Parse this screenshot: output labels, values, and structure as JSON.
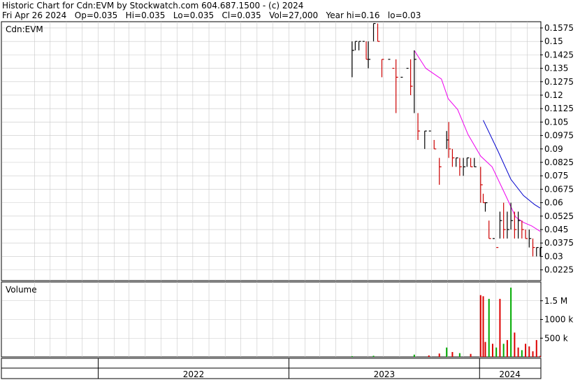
{
  "header": {
    "line1": "Historic Chart for Cdn:EVM by Stockwatch.com 604.687.1500 - (c) 2024",
    "line2": "Fri Apr 26 2024   Op=0.035   Hi=0.035   Lo=0.035   Cl=0.035   Vol=27,000   Year hi=0.16   lo=0.03"
  },
  "colors": {
    "up_bar": "#000000",
    "down_bar": "#cc0000",
    "ma_short": "#ee00ee",
    "ma_long": "#0000cc",
    "volume_up": "#00aa00",
    "volume_down": "#dd0000",
    "grid": "#c8c8c8"
  },
  "chart_data": [
    {
      "type": "ohlc",
      "panel_label": "Cdn:EVM",
      "price_ticks": [
        "0.1575",
        "0.15",
        "0.1425",
        "0.135",
        "0.1275",
        "0.12",
        "0.1125",
        "0.105",
        "0.0975",
        "0.09",
        "0.0825",
        "0.075",
        "0.0675",
        "0.06",
        "0.0525",
        "0.045",
        "0.0375",
        "0.03",
        "0.0225"
      ],
      "ylim": [
        0.0165,
        0.161
      ],
      "x_ticks": [
        "2022",
        "2023",
        "2024"
      ],
      "x_date_range": [
        "2021-07-01",
        "2024-04-26"
      ],
      "price_series": [
        {
          "date": "2023-05-02",
          "h": 0.15,
          "l": 0.13,
          "c": 0.145
        },
        {
          "date": "2023-05-08",
          "h": 0.15,
          "l": 0.145,
          "c": 0.15
        },
        {
          "date": "2023-05-15",
          "h": 0.15,
          "l": 0.145,
          "c": 0.15
        },
        {
          "date": "2023-05-22",
          "h": 0.15,
          "l": 0.15,
          "c": 0.15
        },
        {
          "date": "2023-05-29",
          "h": 0.15,
          "l": 0.14,
          "c": 0.14
        },
        {
          "date": "2023-06-02",
          "h": 0.15,
          "l": 0.135,
          "c": 0.14
        },
        {
          "date": "2023-06-12",
          "h": 0.16,
          "l": 0.15,
          "c": 0.16
        },
        {
          "date": "2023-06-20",
          "h": 0.16,
          "l": 0.15,
          "c": 0.15
        },
        {
          "date": "2023-06-28",
          "h": 0.14,
          "l": 0.13,
          "c": 0.14
        },
        {
          "date": "2023-07-10",
          "h": 0.14,
          "l": 0.14,
          "c": 0.14
        },
        {
          "date": "2023-07-18",
          "h": 0.135,
          "l": 0.135,
          "c": 0.135
        },
        {
          "date": "2023-07-25",
          "h": 0.14,
          "l": 0.11,
          "c": 0.13
        },
        {
          "date": "2023-08-03",
          "h": 0.13,
          "l": 0.13,
          "c": 0.13
        },
        {
          "date": "2023-08-14",
          "h": 0.135,
          "l": 0.135,
          "c": 0.135
        },
        {
          "date": "2023-08-22",
          "h": 0.14,
          "l": 0.12,
          "c": 0.125
        },
        {
          "date": "2023-08-29",
          "h": 0.145,
          "l": 0.11,
          "c": 0.14
        },
        {
          "date": "2023-09-05",
          "h": 0.11,
          "l": 0.095,
          "c": 0.1
        },
        {
          "date": "2023-09-18",
          "h": 0.1,
          "l": 0.09,
          "c": 0.1
        },
        {
          "date": "2023-09-26",
          "h": 0.1,
          "l": 0.1,
          "c": 0.1
        },
        {
          "date": "2023-10-06",
          "h": 0.095,
          "l": 0.09,
          "c": 0.09
        },
        {
          "date": "2023-10-16",
          "h": 0.085,
          "l": 0.07,
          "c": 0.08
        },
        {
          "date": "2023-10-30",
          "h": 0.1,
          "l": 0.09,
          "c": 0.095
        },
        {
          "date": "2023-11-03",
          "h": 0.105,
          "l": 0.085,
          "c": 0.09
        },
        {
          "date": "2023-11-10",
          "h": 0.09,
          "l": 0.08,
          "c": 0.085
        },
        {
          "date": "2023-11-17",
          "h": 0.085,
          "l": 0.08,
          "c": 0.085
        },
        {
          "date": "2023-11-24",
          "h": 0.085,
          "l": 0.075,
          "c": 0.08
        },
        {
          "date": "2023-12-01",
          "h": 0.085,
          "l": 0.075,
          "c": 0.08
        },
        {
          "date": "2023-12-08",
          "h": 0.085,
          "l": 0.08,
          "c": 0.085
        },
        {
          "date": "2023-12-15",
          "h": 0.085,
          "l": 0.08,
          "c": 0.08
        },
        {
          "date": "2023-12-22",
          "h": 0.085,
          "l": 0.08,
          "c": 0.08
        },
        {
          "date": "2024-01-03",
          "h": 0.08,
          "l": 0.06,
          "c": 0.07
        },
        {
          "date": "2024-01-08",
          "h": 0.065,
          "l": 0.06,
          "c": 0.06
        },
        {
          "date": "2024-01-12",
          "h": 0.06,
          "l": 0.055,
          "c": 0.06
        },
        {
          "date": "2024-01-19",
          "h": 0.05,
          "l": 0.04,
          "c": 0.04
        },
        {
          "date": "2024-01-26",
          "h": 0.04,
          "l": 0.04,
          "c": 0.04
        },
        {
          "date": "2024-02-02",
          "h": 0.035,
          "l": 0.035,
          "c": 0.035
        },
        {
          "date": "2024-02-09",
          "h": 0.055,
          "l": 0.04,
          "c": 0.05
        },
        {
          "date": "2024-02-16",
          "h": 0.06,
          "l": 0.04,
          "c": 0.045
        },
        {
          "date": "2024-02-23",
          "h": 0.055,
          "l": 0.04,
          "c": 0.045
        },
        {
          "date": "2024-03-01",
          "h": 0.06,
          "l": 0.045,
          "c": 0.05
        },
        {
          "date": "2024-03-08",
          "h": 0.055,
          "l": 0.04,
          "c": 0.045
        },
        {
          "date": "2024-03-15",
          "h": 0.055,
          "l": 0.04,
          "c": 0.05
        },
        {
          "date": "2024-03-22",
          "h": 0.05,
          "l": 0.04,
          "c": 0.045
        },
        {
          "date": "2024-03-29",
          "h": 0.045,
          "l": 0.04,
          "c": 0.04
        },
        {
          "date": "2024-04-05",
          "h": 0.045,
          "l": 0.035,
          "c": 0.04
        },
        {
          "date": "2024-04-12",
          "h": 0.04,
          "l": 0.03,
          "c": 0.035
        },
        {
          "date": "2024-04-19",
          "h": 0.035,
          "l": 0.03,
          "c": 0.035
        },
        {
          "date": "2024-04-26",
          "h": 0.035,
          "l": 0.03,
          "c": 0.035
        }
      ],
      "moving_averages": [
        {
          "color_key": "ma_short",
          "points": [
            {
              "date": "2023-08-29",
              "v": 0.145
            },
            {
              "date": "2023-09-20",
              "v": 0.135
            },
            {
              "date": "2023-10-20",
              "v": 0.129
            },
            {
              "date": "2023-11-02",
              "v": 0.118
            },
            {
              "date": "2023-11-20",
              "v": 0.112
            },
            {
              "date": "2023-12-10",
              "v": 0.098
            },
            {
              "date": "2024-01-03",
              "v": 0.086
            },
            {
              "date": "2024-01-25",
              "v": 0.08
            },
            {
              "date": "2024-02-20",
              "v": 0.064
            },
            {
              "date": "2024-03-10",
              "v": 0.052
            },
            {
              "date": "2024-03-25",
              "v": 0.049
            },
            {
              "date": "2024-04-10",
              "v": 0.047
            },
            {
              "date": "2024-04-26",
              "v": 0.044
            }
          ]
        },
        {
          "color_key": "ma_long",
          "points": [
            {
              "date": "2024-01-08",
              "v": 0.106
            },
            {
              "date": "2024-02-05",
              "v": 0.089
            },
            {
              "date": "2024-03-01",
              "v": 0.073
            },
            {
              "date": "2024-03-25",
              "v": 0.064
            },
            {
              "date": "2024-04-15",
              "v": 0.059
            },
            {
              "date": "2024-04-26",
              "v": 0.057
            }
          ]
        }
      ]
    },
    {
      "type": "bar",
      "panel_label": "Volume",
      "volume_ticks": [
        "1.5 M",
        "1000 k",
        "500 k"
      ],
      "ylim": [
        0,
        2000000
      ],
      "volume_series": [
        {
          "date": "2023-05-02",
          "v": 20000,
          "dir": "up"
        },
        {
          "date": "2023-06-12",
          "v": 30000,
          "dir": "up"
        },
        {
          "date": "2023-08-29",
          "v": 60000,
          "dir": "up"
        },
        {
          "date": "2023-09-26",
          "v": 40000,
          "dir": "down"
        },
        {
          "date": "2023-10-16",
          "v": 90000,
          "dir": "down"
        },
        {
          "date": "2023-10-30",
          "v": 250000,
          "dir": "up"
        },
        {
          "date": "2023-11-10",
          "v": 130000,
          "dir": "down"
        },
        {
          "date": "2023-11-24",
          "v": 100000,
          "dir": "up"
        },
        {
          "date": "2023-12-15",
          "v": 80000,
          "dir": "down"
        },
        {
          "date": "2024-01-03",
          "v": 1650000,
          "dir": "down"
        },
        {
          "date": "2024-01-08",
          "v": 1620000,
          "dir": "down"
        },
        {
          "date": "2024-01-12",
          "v": 400000,
          "dir": "down"
        },
        {
          "date": "2024-01-19",
          "v": 1550000,
          "dir": "up"
        },
        {
          "date": "2024-01-26",
          "v": 350000,
          "dir": "down"
        },
        {
          "date": "2024-02-02",
          "v": 250000,
          "dir": "up"
        },
        {
          "date": "2024-02-09",
          "v": 1550000,
          "dir": "down"
        },
        {
          "date": "2024-02-16",
          "v": 350000,
          "dir": "up"
        },
        {
          "date": "2024-02-23",
          "v": 450000,
          "dir": "down"
        },
        {
          "date": "2024-03-01",
          "v": 1850000,
          "dir": "up"
        },
        {
          "date": "2024-03-08",
          "v": 650000,
          "dir": "down"
        },
        {
          "date": "2024-03-15",
          "v": 250000,
          "dir": "down"
        },
        {
          "date": "2024-03-22",
          "v": 180000,
          "dir": "up"
        },
        {
          "date": "2024-03-29",
          "v": 350000,
          "dir": "down"
        },
        {
          "date": "2024-04-05",
          "v": 280000,
          "dir": "down"
        },
        {
          "date": "2024-04-12",
          "v": 150000,
          "dir": "down"
        },
        {
          "date": "2024-04-19",
          "v": 450000,
          "dir": "down"
        },
        {
          "date": "2024-04-26",
          "v": 27000,
          "dir": "down"
        }
      ]
    }
  ]
}
